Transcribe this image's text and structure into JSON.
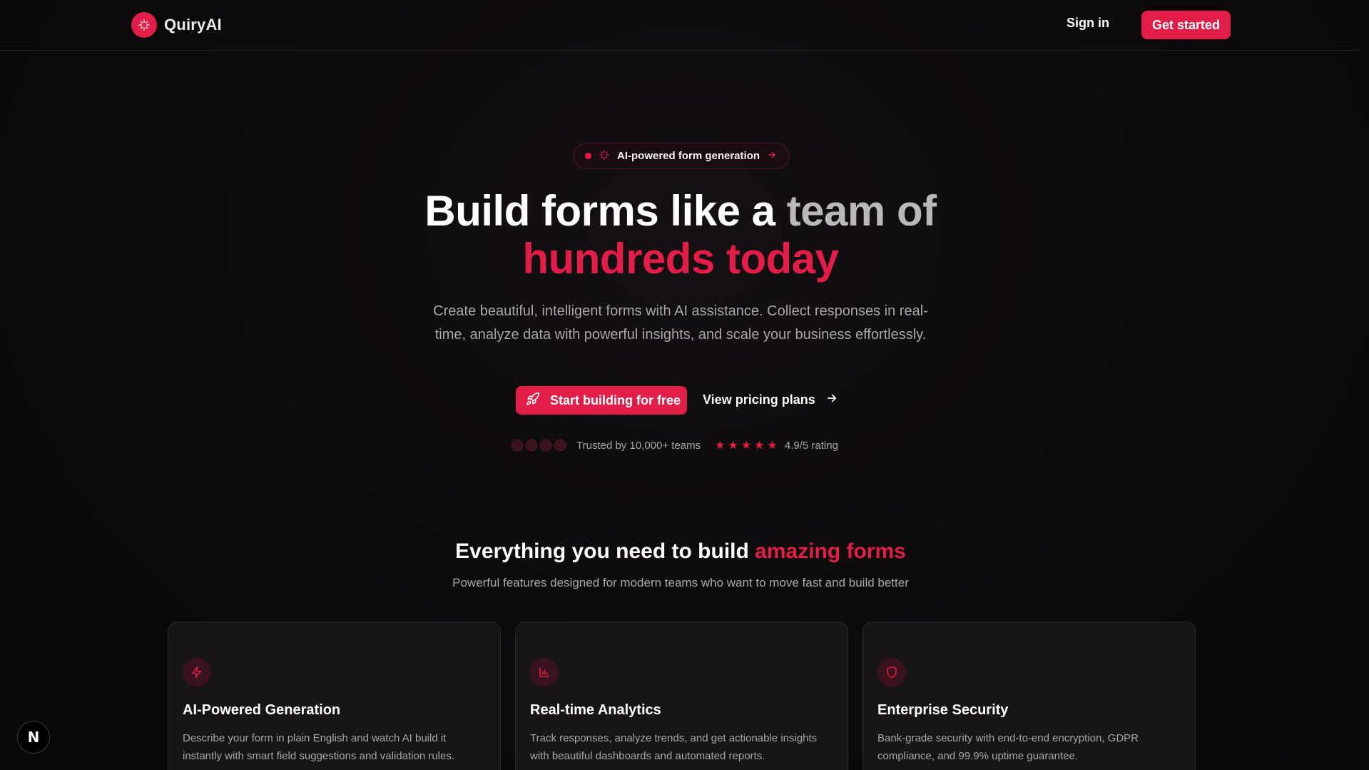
{
  "header": {
    "brand": "QuiryAI",
    "signin_label": "Sign in",
    "getstarted_label": "Get started"
  },
  "badge": {
    "label": "AI-powered form generation"
  },
  "hero": {
    "title_line1_main": "Build forms like a ",
    "title_line1_fade": "team of",
    "title_line2": "hundreds today",
    "subtitle": "Create beautiful, intelligent forms with AI assistance. Collect responses in real-time, analyze data with powerful insights, and scale your business effortlessly.",
    "cta_primary": "Start building for free",
    "cta_secondary": "View pricing plans"
  },
  "trust": {
    "teams_text": "Trusted by 10,000+ teams",
    "rating_text": "4.9/5 rating",
    "stars": 5
  },
  "features": {
    "title_main": "Everything you need to build ",
    "title_accent": "amazing forms",
    "subtitle": "Powerful features designed for modern teams who want to move fast and build better",
    "cards": [
      {
        "icon": "lightning-icon",
        "title": "AI-Powered Generation",
        "description": "Describe your form in plain English and watch AI build it instantly with smart field suggestions and validation rules."
      },
      {
        "icon": "bar-chart-icon",
        "title": "Real-time Analytics",
        "description": "Track responses, analyze trends, and get actionable insights with beautiful dashboards and automated reports."
      },
      {
        "icon": "shield-icon",
        "title": "Enterprise Security",
        "description": "Bank-grade security with end-to-end encryption, GDPR compliance, and 99.9% uptime guarantee."
      }
    ]
  },
  "floating_badge": {
    "label": "N"
  },
  "colors": {
    "accent": "#e11d48",
    "background": "#0d0a0c",
    "card": "#171516"
  }
}
